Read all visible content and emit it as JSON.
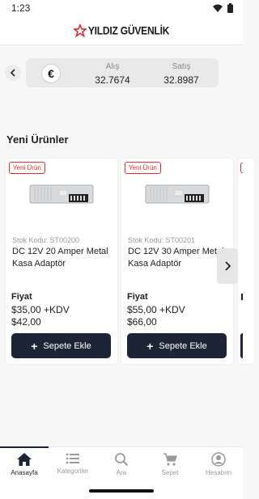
{
  "status_bar": {
    "time": "1:23"
  },
  "header": {
    "logo_text": "YILDIZ GÜVENLİK"
  },
  "currency": {
    "symbol": "€",
    "buy_label": "Alış",
    "buy_value": "32.7674",
    "sell_label": "Satış",
    "sell_value": "32.8987"
  },
  "section": {
    "title": "Yeni Ürünler"
  },
  "products": [
    {
      "badge": "Yeni Ürün",
      "stock_code": "Stok Kodu: ST00200",
      "name": "DC 12V 20 Amper Metal Kasa Adaptör",
      "price_label": "Fiyat",
      "price_excl": "$35,00 +KDV",
      "price_incl": "$42,00",
      "button_label": "Sepete Ekle"
    },
    {
      "badge": "Yeni Ürün",
      "stock_code": "Stok Kodu: ST00201",
      "name": "DC 12V 30 Amper Metal Kasa  Adaptör",
      "price_label": "Fiyat",
      "price_excl": "$55,00 +KDV",
      "price_incl": "$66,00",
      "button_label": "Sepete Ekle"
    }
  ],
  "nav": {
    "items": [
      {
        "label": "Anasayfa",
        "icon": "home-icon",
        "active": true
      },
      {
        "label": "Kategoriler",
        "icon": "list-icon",
        "active": false
      },
      {
        "label": "Ara",
        "icon": "search-icon",
        "active": false
      },
      {
        "label": "Sepet",
        "icon": "cart-icon",
        "active": false
      },
      {
        "label": "Hesabım",
        "icon": "account-icon",
        "active": false
      }
    ]
  },
  "colors": {
    "primary": "#1b2536",
    "badge": "#e2302a",
    "logo_star": "#d4232a"
  }
}
